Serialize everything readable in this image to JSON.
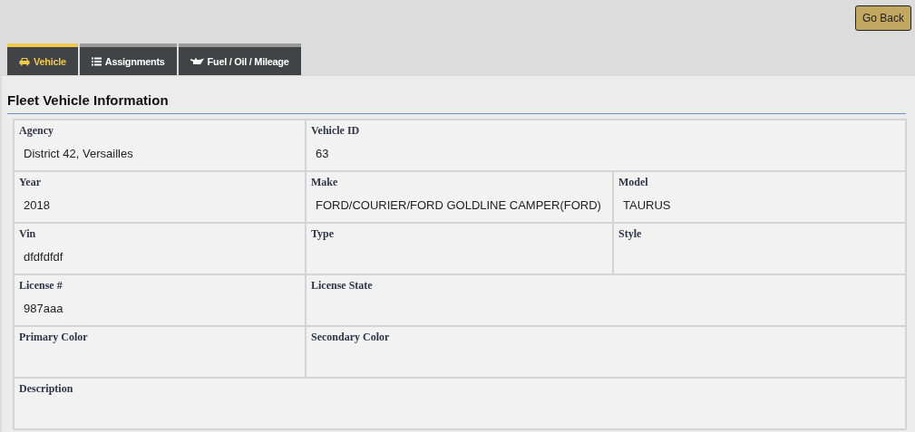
{
  "go_back_button": "Go Back",
  "tabs": [
    {
      "label": "Vehicle",
      "kind": "car",
      "selected": true
    },
    {
      "label": "Assignments",
      "kind": "list",
      "selected": false
    },
    {
      "label": "Fuel / Oil / Mileage",
      "kind": "oil",
      "selected": false
    }
  ],
  "section_title": "Fleet Vehicle Information",
  "rows": [
    [
      {
        "label": "Agency",
        "value": "District 42, Versailles"
      },
      {
        "label": "Vehicle ID",
        "value": "63"
      }
    ],
    [
      {
        "label": "Year",
        "value": "2018"
      },
      {
        "label": "Make",
        "value": "FORD/COURIER/FORD GOLDLINE CAMPER(FORD)"
      },
      {
        "label": "Model",
        "value": "TAURUS"
      }
    ],
    [
      {
        "label": "Vin",
        "value": "dfdfdfdf"
      },
      {
        "label": "Type"
      },
      {
        "label": "Style"
      }
    ],
    [
      {
        "label": "License #",
        "value": "987aaa"
      },
      {
        "label": "License State"
      }
    ],
    [
      {
        "label": "Primary Color"
      },
      {
        "label": "Secondary Color"
      }
    ],
    [
      {
        "label": "Description"
      }
    ]
  ]
}
